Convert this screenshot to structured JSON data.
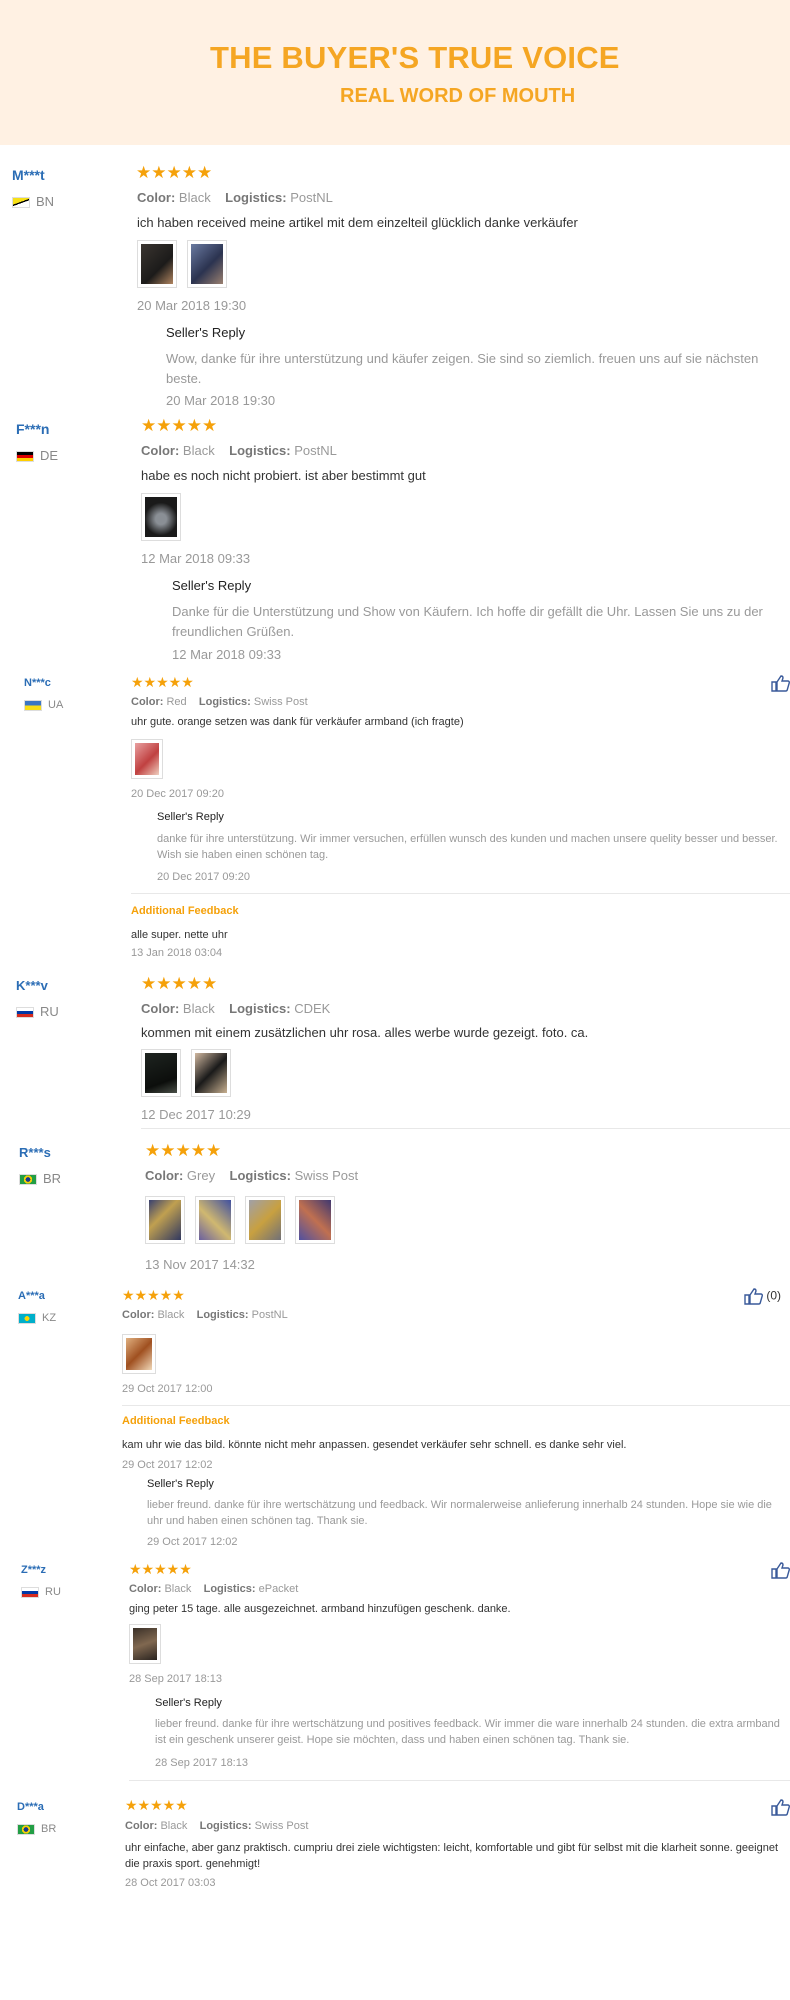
{
  "hero": {
    "title": "THE BUYER'S TRUE VOICE",
    "subtitle": "REAL WORD OF MOUTH"
  },
  "labels": {
    "color": "Color:",
    "logistics": "Logistics:",
    "seller_reply": "Seller's Reply",
    "additional_feedback": "Additional Feedback",
    "stars": "★★★★★"
  },
  "colors": {
    "accent": "#f5a623",
    "user": "#2b6db5",
    "hero_bg": "#fff1e3"
  },
  "reviews": [
    {
      "user": "M***t",
      "country": "BN",
      "color": "Black",
      "logistics": "PostNL",
      "text": "ich haben received meine artikel mit dem einzelteil glücklich danke verkäufer",
      "date": "20 Mar 2018 19:30",
      "reply": "Wow, danke für ihre unterstützung und käufer zeigen. Sie sind so ziemlich. freuen uns auf sie nächsten beste.",
      "reply_date": "20 Mar 2018 19:30"
    },
    {
      "user": "F***n",
      "country": "DE",
      "color": "Black",
      "logistics": "PostNL",
      "text": "habe es noch nicht probiert. ist aber bestimmt gut",
      "date": "12 Mar 2018 09:33",
      "reply": "Danke für die Unterstützung und Show von Käufern. Ich hoffe dir gefällt die Uhr. Lassen Sie uns zu der freundlichen Grüßen.",
      "reply_date": "12 Mar 2018 09:33"
    },
    {
      "user": "N***c",
      "country": "UA",
      "color": "Red",
      "logistics": "Swiss Post",
      "text": "uhr gute. orange setzen was dank für verkäufer armband (ich fragte)",
      "date": "20 Dec 2017 09:20",
      "reply": "danke für ihre unterstützung. Wir immer versuchen, erfüllen wunsch des kunden und machen unsere quelity besser und besser. Wish sie haben einen schönen tag.",
      "reply_date": "20 Dec 2017 09:20",
      "additional": "alle super. nette uhr",
      "additional_date": "13 Jan 2018 03:04"
    },
    {
      "user": "K***v",
      "country": "RU",
      "color": "Black",
      "logistics": "CDEK",
      "text": "kommen mit einem zusätzlichen uhr rosa. alles werbe wurde gezeigt. foto. ca.",
      "date": "12 Dec 2017 10:29"
    },
    {
      "user": "R***s",
      "country": "BR",
      "color": "Grey",
      "logistics": "Swiss Post",
      "date": "13 Nov 2017 14:32"
    },
    {
      "user": "A***a",
      "country": "KZ",
      "color": "Black",
      "logistics": "PostNL",
      "date": "29 Oct 2017 12:00",
      "like_count": "(0)",
      "additional": "kam uhr wie das bild. könnte nicht mehr anpassen. gesendet verkäufer sehr schnell. es danke sehr viel.",
      "additional_date": "29 Oct 2017 12:02",
      "reply": "lieber freund. danke für ihre wertschätzung und feedback. Wir normalerweise anlieferung innerhalb 24 stunden. Hope sie wie die uhr und haben einen schönen tag. Thank sie.",
      "reply_date": "29 Oct 2017 12:02"
    },
    {
      "user": "Z***z",
      "country": "RU",
      "color": "Black",
      "logistics": "ePacket",
      "text": "ging peter 15 tage. alle ausgezeichnet. armband hinzufügen geschenk. danke.",
      "date": "28 Sep 2017 18:13",
      "reply": "lieber freund. danke für ihre wertschätzung und positives feedback. Wir immer die ware innerhalb 24 stunden. die extra armband ist ein geschenk unserer geist. Hope sie möchten, dass und haben einen schönen tag. Thank sie.",
      "reply_date": "28 Sep 2017 18:13"
    },
    {
      "user": "D***a",
      "country": "BR",
      "color": "Black",
      "logistics": "Swiss Post",
      "text": "uhr einfache, aber ganz praktisch. cumpriu drei ziele wichtigsten: leicht, komfortable und gibt für selbst mit die klarheit sonne. geeignet die praxis sport. genehmigt!",
      "date": "28 Oct 2017 03:03"
    }
  ]
}
